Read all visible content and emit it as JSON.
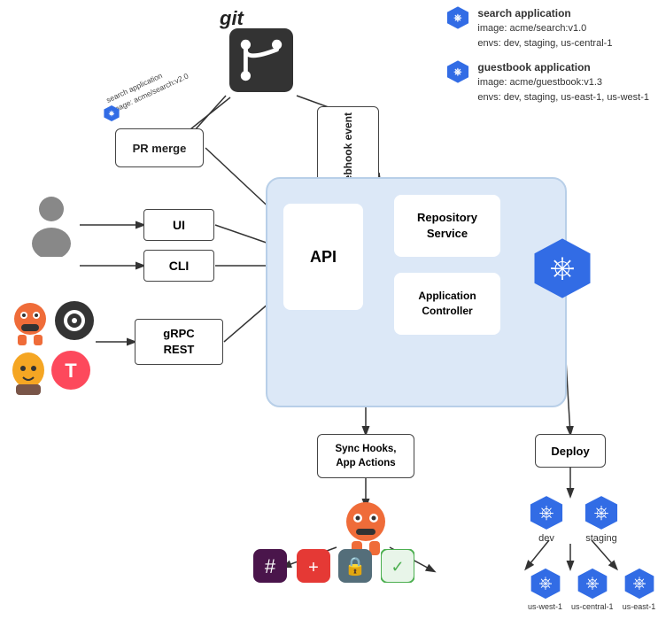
{
  "git": {
    "label": "git"
  },
  "apps": {
    "search": {
      "name": "search application",
      "image": "image: acme/search:v1.0",
      "envs": "envs: dev, staging, us-central-1"
    },
    "guestbook": {
      "name": "guestbook application",
      "image": "image: acme/guestbook:v1.3",
      "envs": "envs: dev, staging, us-east-1, us-west-1"
    }
  },
  "pr_merge": {
    "label": "PR merge"
  },
  "webhook": {
    "label": "webhook\nevent"
  },
  "search_app_rotated": {
    "line1": "search application",
    "line2": "image: acme/search:v2.0"
  },
  "ui_box": {
    "label": "UI"
  },
  "cli_box": {
    "label": "CLI"
  },
  "grpc_box": {
    "label": "gRPC\nREST"
  },
  "api_box": {
    "label": "API"
  },
  "repo_service": {
    "label": "Repository\nService"
  },
  "app_controller": {
    "label": "Application\nController"
  },
  "sync_box": {
    "label": "Sync Hooks,\nApp Actions"
  },
  "deploy_box": {
    "label": "Deploy"
  },
  "clusters": {
    "top_row": [
      {
        "label": "dev"
      },
      {
        "label": "staging"
      }
    ],
    "bottom_row": [
      {
        "label": "us-west-1"
      },
      {
        "label": "us-central-1"
      },
      {
        "label": "us-east-1"
      }
    ]
  },
  "icons": {
    "person": "person",
    "git": "git-logo",
    "k8s": "kubernetes",
    "slack": "slack",
    "shield": "shield",
    "clipboard": "clipboard"
  }
}
